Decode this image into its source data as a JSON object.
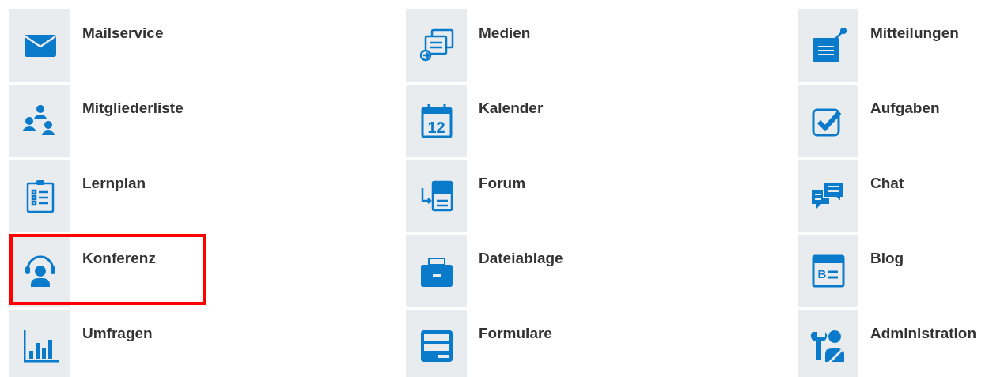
{
  "columns": [
    {
      "items": [
        {
          "label": "Mailservice",
          "kind": "mail",
          "highlighted": false
        },
        {
          "label": "Mitgliederliste",
          "kind": "members",
          "highlighted": false
        },
        {
          "label": "Lernplan",
          "kind": "clipboard",
          "highlighted": false
        },
        {
          "label": "Konferenz",
          "kind": "headset",
          "highlighted": true
        },
        {
          "label": "Umfragen",
          "kind": "chart",
          "highlighted": false
        }
      ]
    },
    {
      "items": [
        {
          "label": "Medien",
          "kind": "media",
          "highlighted": false
        },
        {
          "label": "Kalender",
          "kind": "calendar",
          "icon_text": "12",
          "highlighted": false
        },
        {
          "label": "Forum",
          "kind": "forum",
          "highlighted": false
        },
        {
          "label": "Dateiablage",
          "kind": "folder",
          "highlighted": false
        },
        {
          "label": "Formulare",
          "kind": "form",
          "highlighted": false
        }
      ]
    },
    {
      "items": [
        {
          "label": "Mitteilungen",
          "kind": "notice",
          "highlighted": false
        },
        {
          "label": "Aufgaben",
          "kind": "check",
          "highlighted": false
        },
        {
          "label": "Chat",
          "kind": "chat",
          "highlighted": false
        },
        {
          "label": "Blog",
          "kind": "blog",
          "icon_text": "B",
          "highlighted": false
        },
        {
          "label": "Administration",
          "kind": "admin",
          "highlighted": false
        }
      ]
    }
  ]
}
